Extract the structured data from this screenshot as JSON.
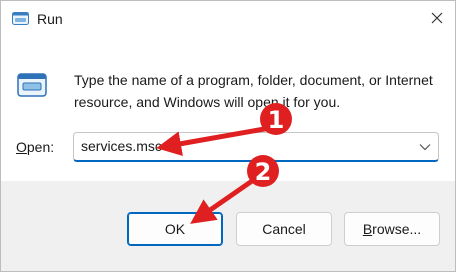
{
  "window": {
    "title": "Run"
  },
  "dialog": {
    "description": "Type the name of a program, folder, document, or Internet resource, and Windows will open it for you.",
    "open_label_prefix": "",
    "open_label_access": "O",
    "open_label_rest": "pen:",
    "open_value": "services.msc"
  },
  "buttons": {
    "ok": "OK",
    "cancel": "Cancel",
    "browse_access": "B",
    "browse_rest": "rowse..."
  },
  "annotations": [
    {
      "number": "1"
    },
    {
      "number": "2"
    }
  ],
  "colors": {
    "accent": "#0067c0",
    "annotation": "#e02020"
  }
}
